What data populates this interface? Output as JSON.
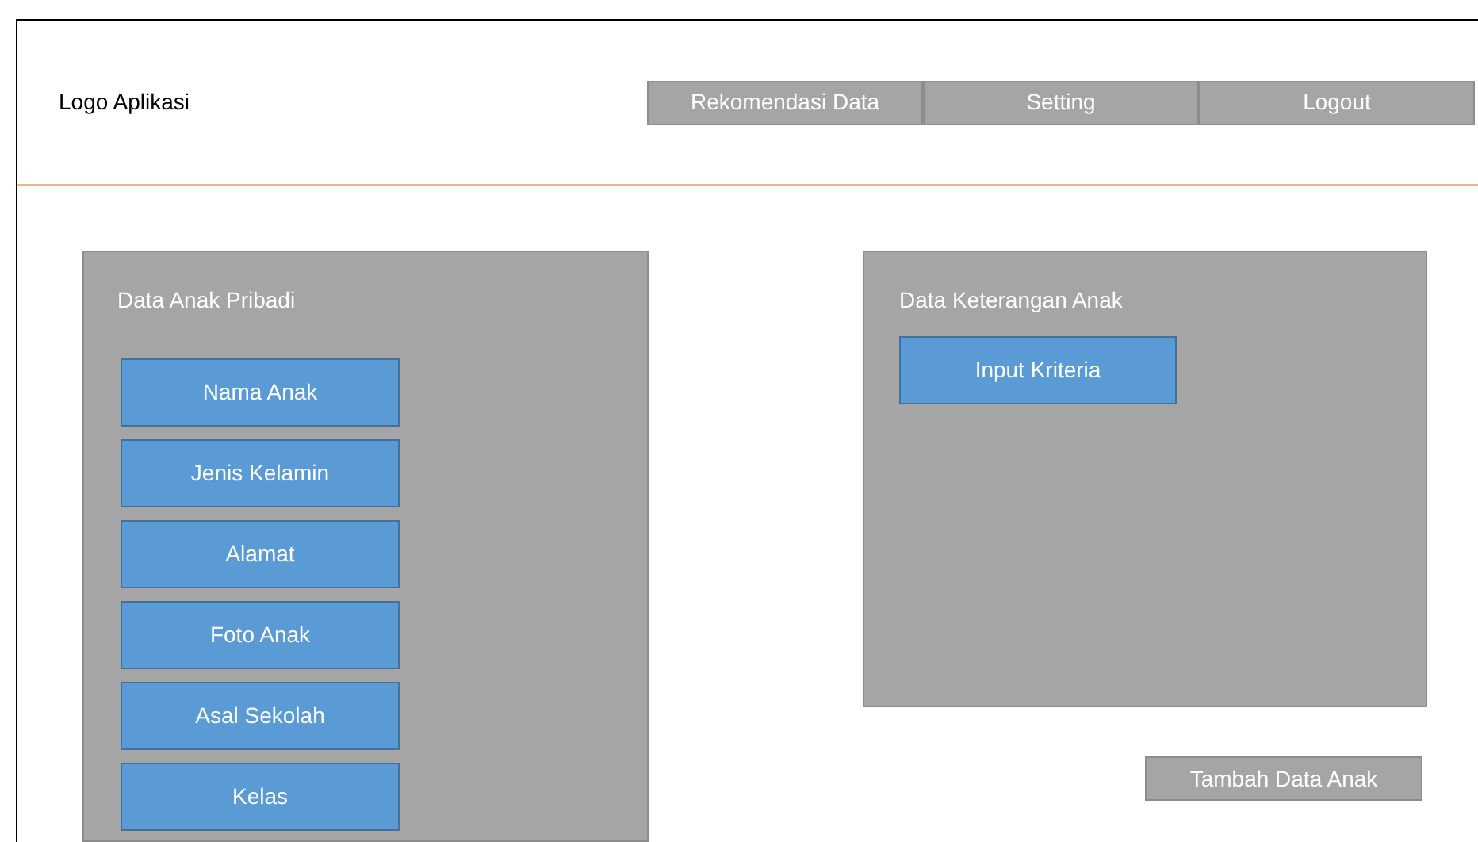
{
  "header": {
    "logo": "Logo Aplikasi",
    "nav": [
      "Rekomendasi Data",
      "Setting",
      "Logout"
    ]
  },
  "left_panel": {
    "title": "Data Anak Pribadi",
    "buttons": [
      "Nama Anak",
      "Jenis Kelamin",
      "Alamat",
      "Foto Anak",
      "Asal Sekolah",
      "Kelas"
    ]
  },
  "right_panel": {
    "title": "Data Keterangan Anak",
    "buttons": [
      "Input Kriteria"
    ]
  },
  "action_button": "Tambah Data Anak"
}
